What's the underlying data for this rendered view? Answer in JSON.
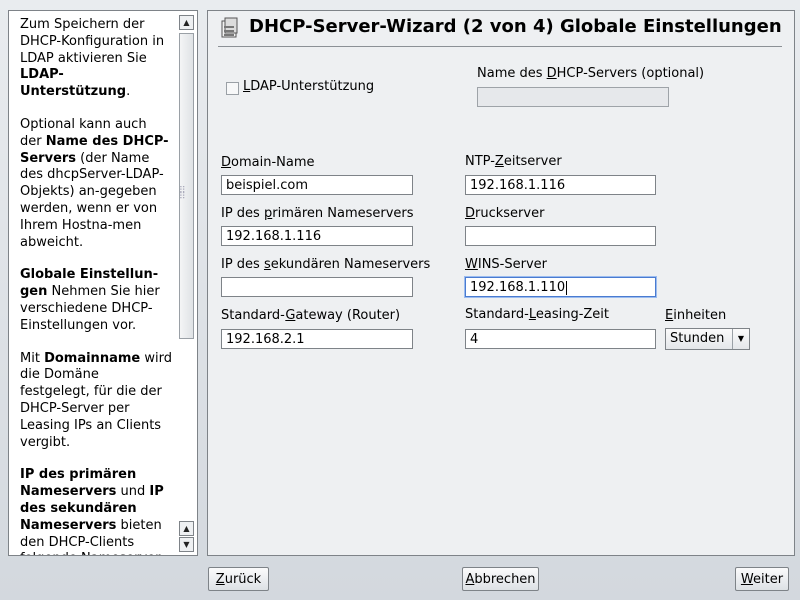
{
  "wizard": {
    "title": "DHCP-Server-Wizard (2 von 4) Globale Einstellungen"
  },
  "help": {
    "paragraphs": [
      [
        "Zum Speichern der DHCP-Konfiguration in LDAP aktivieren Sie ",
        "LDAP-Unterstützung",
        "."
      ],
      [
        "Optional kann auch der ",
        "Name des DHCP-Servers",
        " (der Name des dhcpServer-LDAP-Objekts) an-gegeben werden, wenn er von Ihrem Hostna-men abweicht."
      ],
      [
        "",
        "Globale Einstellun-gen",
        " Nehmen Sie hier verschiedene DHCP-Einstellungen vor."
      ],
      [
        "Mit ",
        "Domainname",
        " wird die Domäne festgelegt, für die der DHCP-Server per Leasing IPs an Clients vergibt."
      ],
      [
        "",
        "IP des primären Nameservers",
        " und ",
        "IP des sekundären Nameservers",
        " bieten den DHCP-Clients folgende Nameserver an. Bei diesen Werten"
      ]
    ]
  },
  "form": {
    "ldap_label_pre": "",
    "ldap_label_u": "L",
    "ldap_label_post": "DAP-Unterstützung",
    "ldap_checked": false,
    "server_name_label_pre": "Name des ",
    "server_name_label_u": "D",
    "server_name_label_post": "HCP-Servers (optional)",
    "server_name_value": "",
    "domain_label_pre": "",
    "domain_label_u": "D",
    "domain_label_post": "omain-Name",
    "domain_value": "beispiel.com",
    "ntp_label_pre": "NTP-",
    "ntp_label_u": "Z",
    "ntp_label_post": "eitserver",
    "ntp_value": "192.168.1.116",
    "primary_ns_label_pre": "IP des ",
    "primary_ns_label_u": "p",
    "primary_ns_label_post": "rimären Nameservers",
    "primary_ns_value": "192.168.1.116",
    "print_label_pre": "",
    "print_label_u": "D",
    "print_label_post": "ruckserver",
    "print_value": "",
    "secondary_ns_label_pre": "IP des ",
    "secondary_ns_label_u": "s",
    "secondary_ns_label_post": "ekundären Nameservers",
    "secondary_ns_value": "",
    "wins_label_pre": "",
    "wins_label_u": "W",
    "wins_label_post": "INS-Server",
    "wins_value": "192.168.1.110",
    "gateway_label_pre": "Standard-",
    "gateway_label_u": "G",
    "gateway_label_post": "ateway (Router)",
    "gateway_value": "192.168.2.1",
    "lease_label_pre": "Standard-",
    "lease_label_u": "L",
    "lease_label_post": "easing-Zeit",
    "lease_value": "4",
    "units_label_pre": "",
    "units_label_u": "E",
    "units_label_post": "inheiten",
    "units_value": "Stunden"
  },
  "buttons": {
    "back_u": "Z",
    "back_rest": "urück",
    "cancel_u": "A",
    "cancel_rest": "bbrechen",
    "next_u": "W",
    "next_rest": "eiter"
  }
}
